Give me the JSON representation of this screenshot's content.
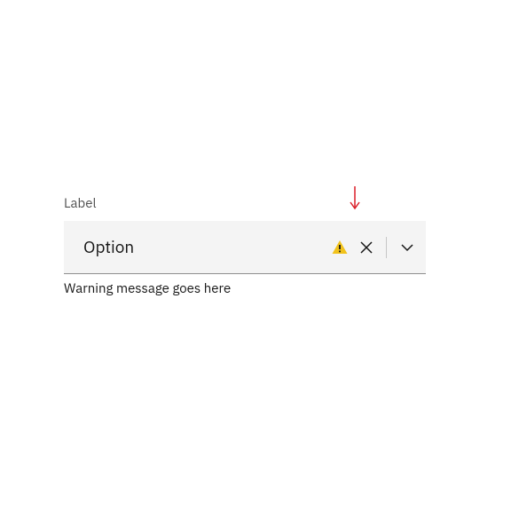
{
  "field": {
    "label": "Label",
    "value": "Option",
    "helper": "Warning message goes here",
    "state": "warning"
  },
  "colors": {
    "warning": "#f1c21b",
    "marker": "#da1e28",
    "text": "#161616",
    "label": "#525252",
    "bg": "#f4f4f4",
    "border": "#8d8d8d"
  }
}
